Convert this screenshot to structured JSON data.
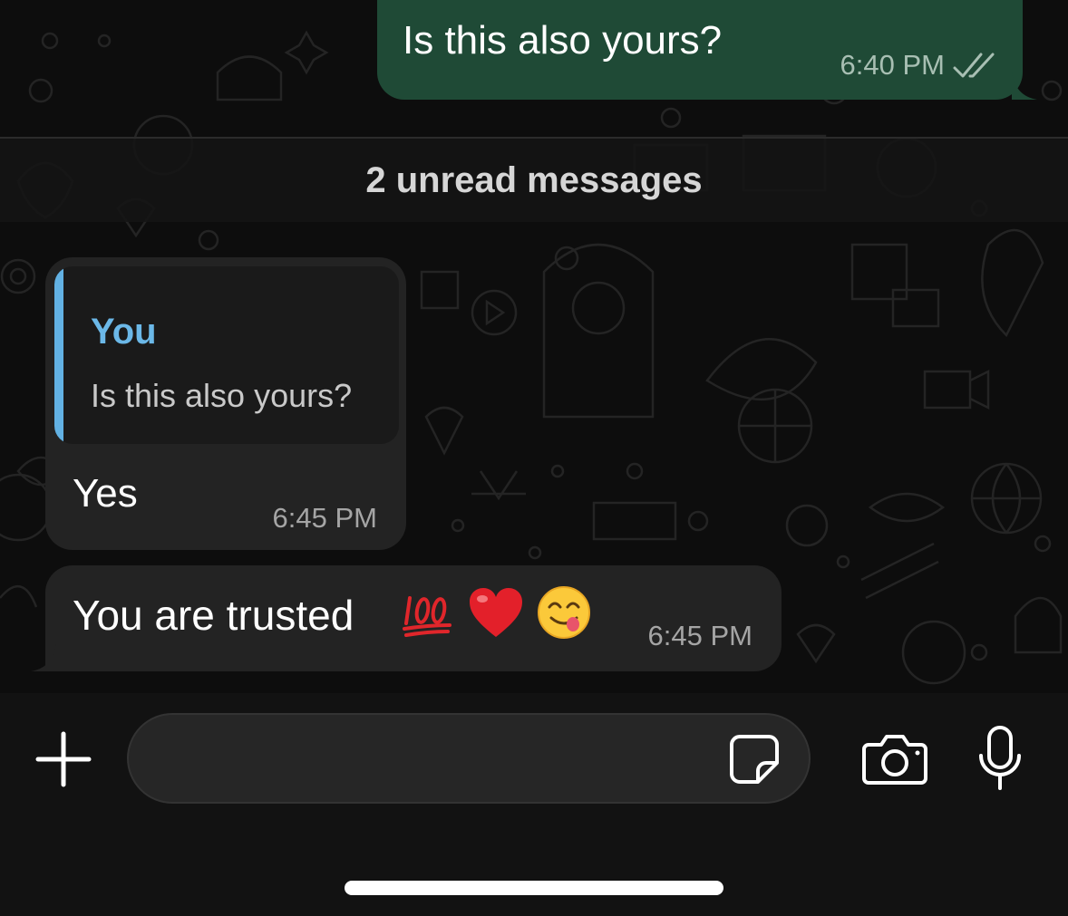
{
  "messages": {
    "outgoing": {
      "text": "Is this also yours?",
      "time": "6:40 PM",
      "status_icon": "double-check-icon"
    },
    "unread_divider": "2 unread messages",
    "reply_message": {
      "quote_author": "You",
      "quote_text": "Is this also yours?",
      "text": "Yes",
      "time": "6:45 PM"
    },
    "trusted_message": {
      "text": "You are trusted",
      "emojis": [
        "hundred-points-emoji",
        "red-heart-emoji",
        "savoring-food-emoji"
      ],
      "time": "6:45 PM"
    }
  },
  "input_bar": {
    "message_value": "",
    "icons": [
      "plus-icon",
      "sticker-icon",
      "camera-icon",
      "microphone-icon"
    ]
  },
  "colors": {
    "outgoing_bubble": "#1f4a36",
    "incoming_bubble": "#232323",
    "quote_accent": "#62b1e3",
    "background": "#0d0d0d"
  }
}
